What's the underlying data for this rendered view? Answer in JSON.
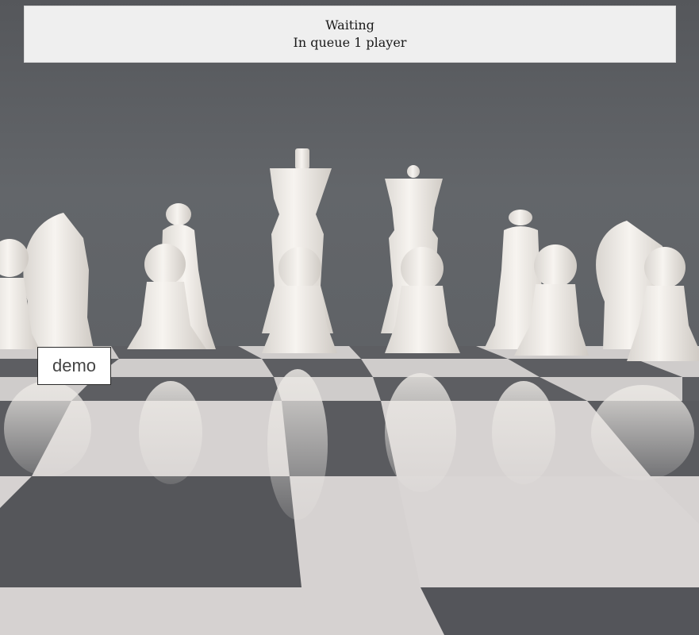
{
  "status": {
    "state_label": "Waiting",
    "queue_text": "In queue 1 player"
  },
  "actions": {
    "demo_label": "demo"
  },
  "background": {
    "scene_colors": {
      "backdrop": "#5c5f63",
      "light_square": "#d9d6d6",
      "dark_square": "#5a5b5f",
      "piece": "#f2efeb"
    }
  }
}
